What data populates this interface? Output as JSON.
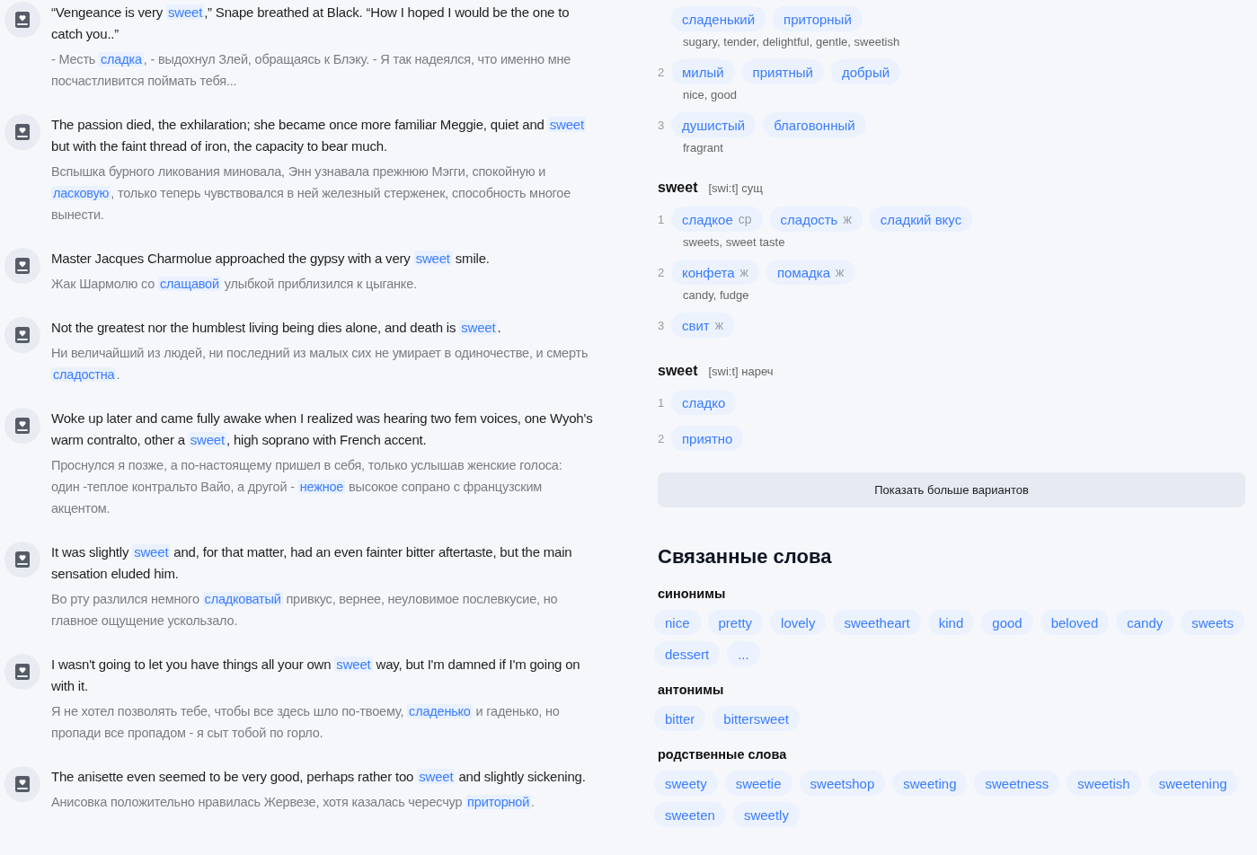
{
  "examples": [
    {
      "en": "“Vengeance is very **sweet**,” Snape breathed at Black. “How I hoped I would be the one to catch you..”",
      "ru": "- Месть **сладка**, - выдохнул Злей, обращаясь к Блэку. - Я так надеялся, что именно мне посчастливится поймать тебя..."
    },
    {
      "en": "The passion died, the exhilaration; she became once more familiar Meggie, quiet and **sweet** but with the faint thread of iron, the capacity to bear much.",
      "ru": "Вспышка бурного ликования миновала, Энн узнавала прежнюю Мэгги, спокойную и **ласковую**, только теперь чувствовался в ней железный стерженек, способность многое вынести."
    },
    {
      "en": "Master Jacques Charmolue approached the gypsy with a very **sweet** smile.",
      "ru": "Жак Шармолю со **слащавой** улыбкой приблизился к цыганке."
    },
    {
      "en": "Not the greatest nor the humblest living being dies alone, and death is **sweet**.",
      "ru": "Ни величайший из людей, ни последний из малых сих не умирает в одиночестве, и смерть **сладостна**."
    },
    {
      "en": "Woke up later and came fully awake when I realized was hearing two fem voices, one Wyoh's warm contralto, other a **sweet**, high soprano with French accent.",
      "ru": "Проснулся я позже, а по-настоящему пришел в себя, только услышав женские голоса: один -теплое контральто Вайо, а другой - **нежное** высокое сопрано с французским акцентом."
    },
    {
      "en": "It was slightly **sweet** and, for that matter, had an even fainter bitter aftertaste, but the main sensation eluded him.",
      "ru": "Во рту разлился немного **сладковатый** привкус, вернее, неуловимое послевкусие, но главное ощущение ускользало."
    },
    {
      "en": "I wasn't going to let you have things all your own **sweet** way, but I'm damned if I'm going on with it.",
      "ru": "Я не хотел позволять тебе, чтобы все здесь шло по-твоему, **сладенько** и гаденько, но пропади все пропадом - я сыт тобой по горло."
    },
    {
      "en": "The anisette even seemed to be very good, perhaps rather too **sweet** and slightly sickening.",
      "ru": "Анисовка положительно нравилась Жервезе, хотя казалась чересчур **приторной**."
    }
  ],
  "dictionary": [
    {
      "senses": [
        {
          "translations": [
            {
              "word": "сладенький"
            },
            {
              "word": "приторный"
            }
          ],
          "gloss": "sugary, tender, delightful, gentle, sweetish"
        },
        {
          "number": "2",
          "translations": [
            {
              "word": "милый"
            },
            {
              "word": "приятный"
            },
            {
              "word": "добрый"
            }
          ],
          "gloss": "nice, good"
        },
        {
          "number": "3",
          "translations": [
            {
              "word": "душистый"
            },
            {
              "word": "благовонный"
            }
          ],
          "gloss": "fragrant"
        }
      ]
    },
    {
      "word": "sweet",
      "transcription": "[swi:t]",
      "pos": "сущ",
      "senses": [
        {
          "number": "1",
          "translations": [
            {
              "word": "сладкое",
              "gender": "ср"
            },
            {
              "word": "сладость",
              "gender": "ж"
            },
            {
              "word": "сладкий вкус"
            }
          ],
          "gloss": "sweets, sweet taste"
        },
        {
          "number": "2",
          "translations": [
            {
              "word": "конфета",
              "gender": "ж"
            },
            {
              "word": "помадка",
              "gender": "ж"
            }
          ],
          "gloss": "candy, fudge"
        },
        {
          "number": "3",
          "translations": [
            {
              "word": "свит",
              "gender": "ж"
            }
          ]
        }
      ]
    },
    {
      "word": "sweet",
      "transcription": "[swi:t]",
      "pos": "нареч",
      "senses": [
        {
          "number": "1",
          "translations": [
            {
              "word": "сладко"
            }
          ]
        },
        {
          "number": "2",
          "translations": [
            {
              "word": "приятно"
            }
          ]
        }
      ]
    }
  ],
  "more_button": "Показать больше вариантов",
  "related": {
    "title": "Связанные слова",
    "groups": [
      {
        "label": "синонимы",
        "words": [
          "nice",
          "pretty",
          "lovely",
          "sweetheart",
          "kind",
          "good",
          "beloved",
          "candy",
          "sweets",
          "dessert",
          "..."
        ]
      },
      {
        "label": "антонимы",
        "words": [
          "bitter",
          "bittersweet"
        ]
      },
      {
        "label": "родственные слова",
        "words": [
          "sweety",
          "sweetie",
          "sweetshop",
          "sweeting",
          "sweetness",
          "sweetish",
          "sweetening",
          "sweeten",
          "sweetly"
        ]
      }
    ]
  }
}
